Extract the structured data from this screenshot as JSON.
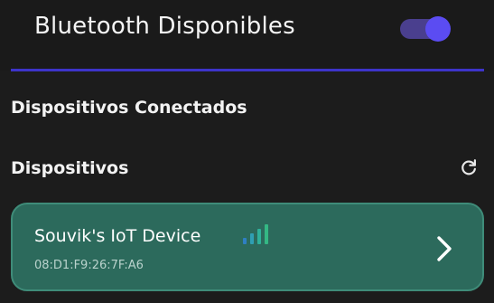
{
  "header": {
    "title": "Bluetooth Disponibles",
    "bluetooth_toggle": "on"
  },
  "sections": {
    "connected_label": "Dispositivos Conectados",
    "devices_label": "Dispositivos"
  },
  "icons": {
    "refresh": "refresh-icon",
    "signal": "signal-strength-icon",
    "chevron": "chevron-right-icon"
  },
  "devices": [
    {
      "name": "Souvik's IoT Device",
      "address": "08:D1:F9:26:7F:A6",
      "signal_bars": 4
    }
  ],
  "colors": {
    "background": "#1c1c1c",
    "accent": "#3d34c9",
    "toggle_thumb": "#5b4cf2",
    "card_background": "#2c6a5c",
    "card_border": "#3f8c79",
    "signal": "#2fa89a"
  }
}
